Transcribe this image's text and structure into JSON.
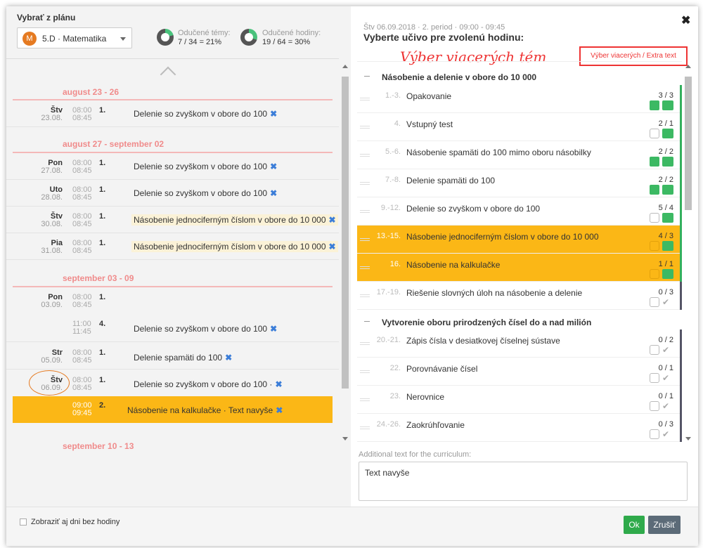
{
  "left_panel": {
    "plan_label": "Vybrať z plánu",
    "class_avatar": "M",
    "class_select": "5.D · Matematika",
    "stats": [
      {
        "label": "Odučené témy:",
        "value": "7 / 34 = 21%",
        "percent": 21
      },
      {
        "label": "Odučené hodiny:",
        "value": "19 / 64 = 30%",
        "percent": 30
      }
    ],
    "weeks": [
      "august 23 - 26",
      "august 27 - september 02",
      "september 03 - 09",
      "september 10 - 13"
    ],
    "lessons": [
      {
        "day": "Štv",
        "date": "23.08.",
        "t1": "08:00",
        "t2": "08:45",
        "n": "1.",
        "text": "Delenie so zvyškom v obore do 100",
        "x": "✖"
      },
      {
        "day": "Pon",
        "date": "27.08.",
        "t1": "08:00",
        "t2": "08:45",
        "n": "1.",
        "text": "Delenie so zvyškom v obore do 100",
        "x": "✖"
      },
      {
        "day": "Uto",
        "date": "28.08.",
        "t1": "08:00",
        "t2": "08:45",
        "n": "1.",
        "text": "Delenie so zvyškom v obore do 100",
        "x": "✖"
      },
      {
        "day": "Štv",
        "date": "30.08.",
        "t1": "08:00",
        "t2": "08:45",
        "n": "1.",
        "text": "Násobenie jednociferným číslom v obore do 10 000",
        "x": "✖"
      },
      {
        "day": "Pia",
        "date": "31.08.",
        "t1": "08:00",
        "t2": "08:45",
        "n": "1.",
        "text": "Násobenie jednociferným číslom v obore do 10 000",
        "x": "✖"
      },
      {
        "day": "Pon",
        "date": "03.09.",
        "t1": "08:00",
        "t2": "08:45",
        "n": "1.",
        "text": "",
        "x": ""
      },
      {
        "day": "",
        "date": "",
        "t1": "11:00",
        "t2": "11:45",
        "n": "4.",
        "text": "Delenie so zvyškom v obore do 100",
        "x": "✖"
      },
      {
        "day": "Str",
        "date": "05.09.",
        "t1": "08:00",
        "t2": "08:45",
        "n": "1.",
        "text": "Delenie spamäti do 100",
        "x": "✖"
      },
      {
        "day": "Štv",
        "date": "06.09.",
        "t1": "08:00",
        "t2": "08:45",
        "n": "1.",
        "text": "Delenie so zvyškom v obore do 100 ·",
        "x": "✖"
      },
      {
        "day": "",
        "date": "",
        "t1": "09:00",
        "t2": "09:45",
        "n": "2.",
        "text": "Násobenie na kalkulačke · Text navyše",
        "x": "✖"
      }
    ],
    "show_days_label": "Zobraziť aj dni bez hodiny"
  },
  "right_panel": {
    "meta": "Štv 06.09.2018 · 2. period · 09:00 - 09:45",
    "title": "Vyberte učivo pre zvolenú hodinu:",
    "annotation": "Výber viacerých tém",
    "multi_button": "Výber viacerých / Extra text",
    "close": "✖",
    "sections": [
      {
        "title": "Násobenie a delenie v obore do 10 000"
      },
      {
        "title": "Vytvorenie oboru prirodzených čísel do a nad milión"
      }
    ],
    "topics": [
      {
        "num": "1.-3.",
        "text": "Opakovanie",
        "count": "3 / 3",
        "lock": "green",
        "check": "green"
      },
      {
        "num": "4.",
        "text": "Vstupný test",
        "count": "2 / 1",
        "lock": "gray",
        "check": "green"
      },
      {
        "num": "5.-6.",
        "text": "Násobenie spamäti do 100 mimo oboru násobilky",
        "count": "2 / 2",
        "lock": "green",
        "check": "green"
      },
      {
        "num": "7.-8.",
        "text": "Delenie spamäti do 100",
        "count": "2 / 2",
        "lock": "green",
        "check": "green"
      },
      {
        "num": "9.-12.",
        "text": "Delenie so zvyškom v obore do 100",
        "count": "5 / 4",
        "lock": "gray",
        "check": "green"
      },
      {
        "num": "13.-15.",
        "text": "Násobenie jednociferným číslom v obore do 10 000",
        "count": "4 / 3",
        "lock": "gray",
        "check": "green"
      },
      {
        "num": "16.",
        "text": "Násobenie na kalkulačke",
        "count": "1 / 1",
        "lock": "gray",
        "check": "green"
      },
      {
        "num": "17.-19.",
        "text": "Riešenie slovných úloh na násobenie a delenie",
        "count": "0 / 3",
        "lock": "gray",
        "check": "gray"
      },
      {
        "num": "20.-21.",
        "text": "Zápis čísla v desiatkovej číselnej sústave",
        "count": "0 / 2",
        "lock": "gray",
        "check": "gray"
      },
      {
        "num": "22.",
        "text": "Porovnávanie čísel",
        "count": "0 / 1",
        "lock": "gray",
        "check": "gray"
      },
      {
        "num": "23.",
        "text": "Nerovnice",
        "count": "0 / 1",
        "lock": "gray",
        "check": "gray"
      },
      {
        "num": "24.-26.",
        "text": "Zaokrúhľovanie",
        "count": "0 / 3",
        "lock": "gray",
        "check": "gray"
      }
    ],
    "additional_label": "Additional text for the curriculum:",
    "additional_value": "Text navyše"
  },
  "footer": {
    "ok": "Ok",
    "cancel": "Zrušiť"
  }
}
